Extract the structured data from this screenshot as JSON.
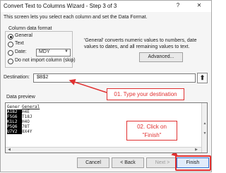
{
  "window": {
    "title": "Convert Text to Columns Wizard - Step 3 of 3",
    "help": "?",
    "close": "✕"
  },
  "intro": "This screen lets you select each column and set the Data Format.",
  "column_data_format": {
    "legend": "Column data format",
    "options": [
      {
        "label": "General",
        "selected": true
      },
      {
        "label": "Text",
        "selected": false
      },
      {
        "label": "Date:",
        "selected": false
      },
      {
        "label": "Do not import column (skip)",
        "selected": false
      }
    ],
    "date_value": "MDY"
  },
  "info_text": "'General' converts numeric values to numbers, date values to dates, and all remaining values to text.",
  "advanced_label": "Advanced...",
  "destination": {
    "label": "Destination:",
    "value": "$B$2"
  },
  "callouts": {
    "one": "01. Type your destination",
    "two_line1": "02. Click on",
    "two_line2": "\"Finish\""
  },
  "preview": {
    "label": "Data preview",
    "header": [
      "Gener",
      "General"
    ],
    "rows": [
      [
        "A1B2",
        "H4E"
      ],
      [
        "F5G6",
        "T18J"
      ],
      [
        "K1L2",
        "H4O"
      ],
      [
        "P5Q6",
        "78T"
      ],
      [
        "U7V2",
        "8X4Y"
      ]
    ]
  },
  "buttons": {
    "cancel": "Cancel",
    "back": "< Back",
    "next": "Next >",
    "finish": "Finish"
  },
  "colors": {
    "annotation": "#e03030",
    "focus": "#2f6fd1"
  }
}
